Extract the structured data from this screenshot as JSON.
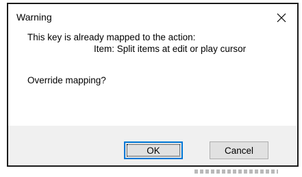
{
  "dialog": {
    "title": "Warning",
    "close_icon": "close-icon",
    "message_line1": "This key is already mapped to the action:",
    "message_line2": "Item: Split items at edit or play cursor",
    "question": "Override mapping?",
    "ok_label": "OK",
    "cancel_label": "Cancel"
  },
  "colors": {
    "accent": "#0078d7",
    "footer_bg": "#f0f0f0",
    "button_bg": "#e1e1e1",
    "border": "#1a1a1a"
  }
}
